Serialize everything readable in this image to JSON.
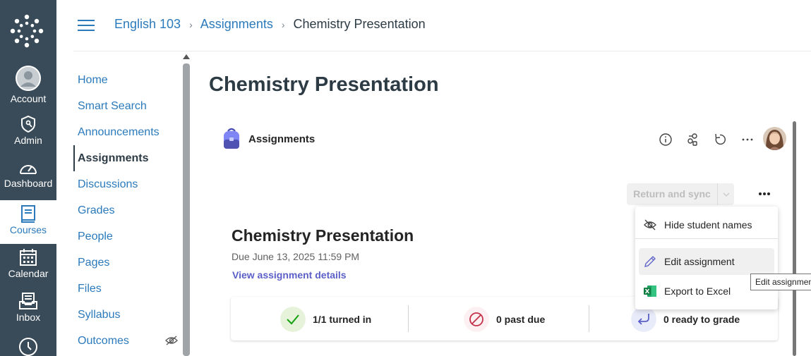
{
  "global_nav": {
    "account": "Account",
    "admin": "Admin",
    "dashboard": "Dashboard",
    "courses": "Courses",
    "calendar": "Calendar",
    "inbox": "Inbox"
  },
  "breadcrumb": {
    "course": "English 103",
    "section": "Assignments",
    "current": "Chemistry Presentation"
  },
  "course_nav": {
    "items": [
      "Home",
      "Smart Search",
      "Announcements",
      "Assignments",
      "Discussions",
      "Grades",
      "People",
      "Pages",
      "Files",
      "Syllabus",
      "Outcomes"
    ],
    "active": "Assignments"
  },
  "page": {
    "title": "Chemistry Presentation"
  },
  "app": {
    "name": "Assignments",
    "return_sync_label": "Return and sync",
    "assignment": {
      "title": "Chemistry Presentation",
      "due": "Due June 13, 2025 11:59 PM",
      "details_link": "View assignment details"
    },
    "stats": {
      "turned_in": "1/1 turned in",
      "past_due": "0 past due",
      "ready": "0 ready to grade"
    },
    "menu": {
      "hide_names": "Hide student names",
      "edit": "Edit assignment",
      "export": "Export to Excel"
    },
    "tooltip": "Edit assignment"
  },
  "colors": {
    "nav_bg": "#394b58",
    "link": "#2b7abc",
    "teams_accent": "#5b5fc7",
    "success_bg": "#e7f2da",
    "danger": "#c4314b"
  },
  "icons": [
    "canvas-logo-icon",
    "account-icon",
    "admin-shield-icon",
    "dashboard-gauge-icon",
    "courses-book-icon",
    "calendar-icon",
    "inbox-icon",
    "history-clock-icon",
    "hamburger-icon",
    "eye-off-icon",
    "backpack-icon",
    "info-icon",
    "share-icon",
    "refresh-icon",
    "more-horizontal-icon",
    "check-icon",
    "prohibited-icon",
    "return-arrow-icon",
    "pencil-icon",
    "excel-icon"
  ]
}
